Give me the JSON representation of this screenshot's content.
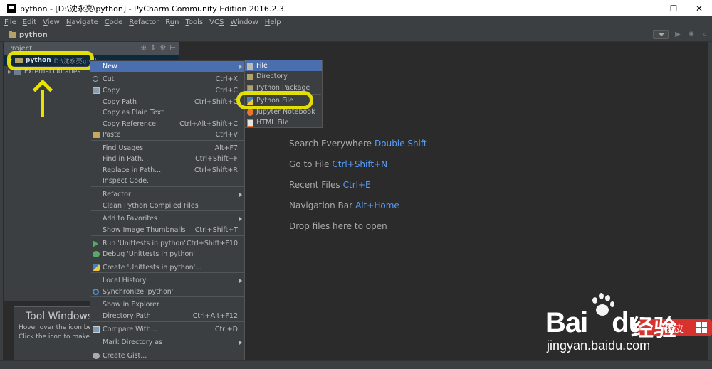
{
  "window": {
    "title": "python - [D:\\沈永亮\\python] - PyCharm Community Edition 2016.2.3",
    "minimize": "—",
    "maximize": "☐",
    "close": "✕"
  },
  "menubar": [
    {
      "label": "File",
      "mnemonic": "F"
    },
    {
      "label": "Edit",
      "mnemonic": "E"
    },
    {
      "label": "View",
      "mnemonic": "V"
    },
    {
      "label": "Navigate",
      "mnemonic": "N"
    },
    {
      "label": "Code",
      "mnemonic": "C"
    },
    {
      "label": "Refactor",
      "mnemonic": "R"
    },
    {
      "label": "Run",
      "mnemonic": "u"
    },
    {
      "label": "Tools",
      "mnemonic": "T"
    },
    {
      "label": "VCS",
      "mnemonic": "S"
    },
    {
      "label": "Window",
      "mnemonic": "W"
    },
    {
      "label": "Help",
      "mnemonic": "H"
    }
  ],
  "navbar": {
    "title": "python",
    "icons": [
      "dropdown-icon",
      "run-icon",
      "debug-icon",
      "search-icon"
    ]
  },
  "project_panel": {
    "header": "Project",
    "tools": [
      "⊕",
      "⇕",
      "⚙",
      "⊢"
    ],
    "tree": [
      {
        "label": "python",
        "path": "D:\\沈永亮\\python",
        "expanded": true,
        "selected": true,
        "icon": "folder-icon"
      },
      {
        "label": "External Libraries",
        "expanded": false,
        "icon": "library-icon"
      }
    ]
  },
  "welcome": [
    {
      "text": "Search Everywhere",
      "key": "Double Shift"
    },
    {
      "text": "Go to File",
      "key": "Ctrl+Shift+N"
    },
    {
      "text": "Recent Files",
      "key": "Ctrl+E"
    },
    {
      "text": "Navigation Bar",
      "key": "Alt+Home"
    },
    {
      "text": "Drop files here to open",
      "key": ""
    }
  ],
  "tool_popup": {
    "title": "Tool Windows",
    "line1": "Hover over the icon below",
    "line2": "Click the icon to make tool"
  },
  "context_menu": [
    {
      "label": "New",
      "shortcut": "",
      "submenu": true,
      "active": true,
      "icon": ""
    },
    {
      "label": "Cut",
      "shortcut": "Ctrl+X",
      "icon": "cut-icon"
    },
    {
      "label": "Copy",
      "shortcut": "Ctrl+C",
      "icon": "copy-icon"
    },
    {
      "label": "Copy Path",
      "shortcut": "Ctrl+Shift+C",
      "icon": ""
    },
    {
      "label": "Copy as Plain Text",
      "shortcut": "",
      "icon": ""
    },
    {
      "label": "Copy Reference",
      "shortcut": "Ctrl+Alt+Shift+C",
      "icon": ""
    },
    {
      "label": "Paste",
      "shortcut": "Ctrl+V",
      "icon": "paste-icon"
    },
    {
      "label": "Find Usages",
      "shortcut": "Alt+F7",
      "icon": ""
    },
    {
      "label": "Find in Path...",
      "shortcut": "Ctrl+Shift+F",
      "icon": ""
    },
    {
      "label": "Replace in Path...",
      "shortcut": "Ctrl+Shift+R",
      "icon": ""
    },
    {
      "label": "Inspect Code...",
      "shortcut": "",
      "icon": ""
    },
    {
      "label": "Refactor",
      "shortcut": "",
      "submenu": true,
      "icon": ""
    },
    {
      "label": "Clean Python Compiled Files",
      "shortcut": "",
      "icon": ""
    },
    {
      "label": "Add to Favorites",
      "shortcut": "",
      "submenu": true,
      "icon": ""
    },
    {
      "label": "Show Image Thumbnails",
      "shortcut": "Ctrl+Shift+T",
      "icon": ""
    },
    {
      "label": "Run 'Unittests in python'",
      "shortcut": "Ctrl+Shift+F10",
      "icon": "run-icon"
    },
    {
      "label": "Debug 'Unittests in python'",
      "shortcut": "",
      "icon": "debug-icon"
    },
    {
      "label": "Create 'Unittests in python'...",
      "shortcut": "",
      "icon": "python-icon"
    },
    {
      "label": "Local History",
      "shortcut": "",
      "submenu": true,
      "icon": ""
    },
    {
      "label": "Synchronize 'python'",
      "shortcut": "",
      "icon": "sync-icon"
    },
    {
      "label": "Show in Explorer",
      "shortcut": "",
      "icon": ""
    },
    {
      "label": "Directory Path",
      "shortcut": "Ctrl+Alt+F12",
      "icon": ""
    },
    {
      "label": "Compare With...",
      "shortcut": "Ctrl+D",
      "icon": "compare-icon"
    },
    {
      "label": "Mark Directory as",
      "shortcut": "",
      "submenu": true,
      "icon": ""
    },
    {
      "label": "Create Gist...",
      "shortcut": "",
      "icon": "github-icon"
    }
  ],
  "new_submenu": [
    {
      "label": "File",
      "icon": "file-icon",
      "active": true
    },
    {
      "label": "Directory",
      "icon": "directory-icon"
    },
    {
      "label": "Python Package",
      "icon": "package-icon"
    },
    {
      "label": "Python File",
      "icon": "python-file-icon"
    },
    {
      "label": "Jupyter Notebook",
      "icon": "jupyter-icon"
    },
    {
      "label": "HTML File",
      "icon": "html-file-icon"
    }
  ],
  "watermark": {
    "logo": "Bai",
    "logo_tail": "du",
    "cn": "经验",
    "url": "jingyan.baidu.com",
    "badge": "換皮"
  },
  "colors": {
    "highlight": "#f4f000",
    "selection": "#4b6eaf",
    "shortcut_blue": "#589df6"
  }
}
